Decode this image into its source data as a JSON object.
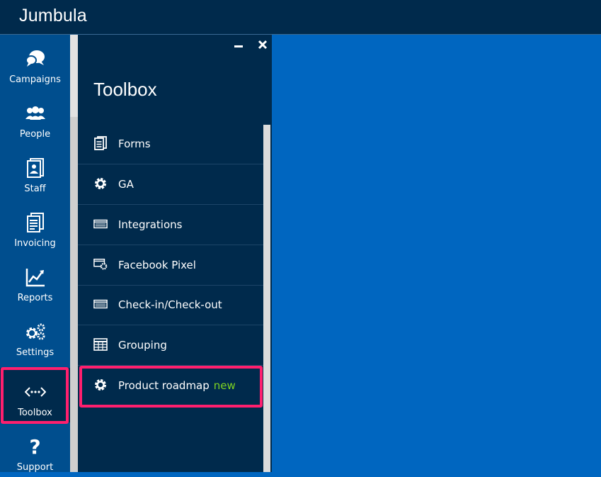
{
  "app": {
    "title": "Jumbula"
  },
  "sidebar": {
    "items": [
      {
        "label": "Campaigns",
        "icon": "chat-bubbles-icon"
      },
      {
        "label": "People",
        "icon": "people-icon"
      },
      {
        "label": "Staff",
        "icon": "staff-badge-icon"
      },
      {
        "label": "Invoicing",
        "icon": "invoice-icon"
      },
      {
        "label": "Reports",
        "icon": "line-chart-icon"
      },
      {
        "label": "Settings",
        "icon": "gears-icon"
      },
      {
        "label": "Toolbox",
        "icon": "code-dots-icon",
        "active": true
      },
      {
        "label": "Support",
        "icon": "question-icon"
      }
    ]
  },
  "panel": {
    "title": "Toolbox",
    "items": [
      {
        "label": "Forms",
        "icon": "form-icon"
      },
      {
        "label": "GA",
        "icon": "gear-icon"
      },
      {
        "label": "Integrations",
        "icon": "card-icon"
      },
      {
        "label": "Facebook Pixel",
        "icon": "card-gear-icon"
      },
      {
        "label": "Check-in/Check-out",
        "icon": "card-icon"
      },
      {
        "label": "Grouping",
        "icon": "table-icon"
      },
      {
        "label": "Product roadmap",
        "icon": "gear-icon",
        "badge": "new"
      }
    ]
  },
  "colors": {
    "topbar": "#002a4c",
    "sidebar": "#004e8e",
    "panel": "#002a4c",
    "main": "#0066c0",
    "highlight": "#ff1f6e",
    "badge": "#7ed321"
  }
}
